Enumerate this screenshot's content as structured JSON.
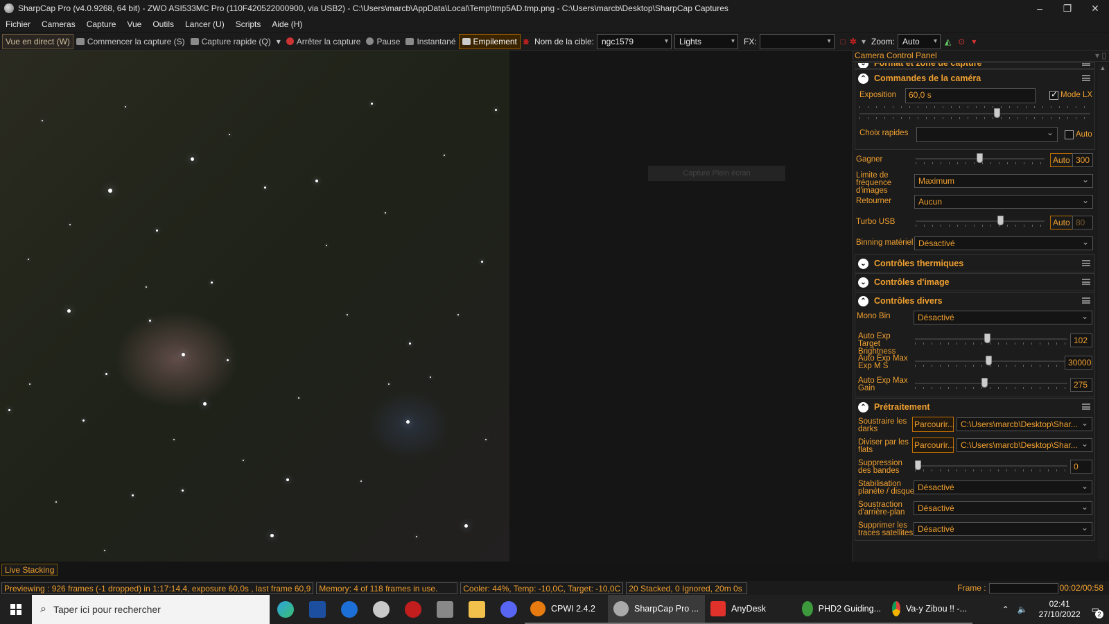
{
  "window": {
    "title": "SharpCap Pro (v4.0.9268, 64 bit) - ZWO ASI533MC Pro (110F420522000900, via USB2) - C:\\Users\\marcb\\AppData\\Local\\Temp\\tmp5AD.tmp.png - C:\\Users\\marcb\\Desktop\\SharpCap Captures"
  },
  "menu": [
    "Fichier",
    "Cameras",
    "Capture",
    "Vue",
    "Outils",
    "Lancer (U)",
    "Scripts",
    "Aide (H)"
  ],
  "toolbar": {
    "live_view": "Vue en direct (W)",
    "start_capture": "Commencer la capture (S)",
    "quick_capture": "Capture rapide (Q)",
    "stop_capture": "Arrêter la capture",
    "pause": "Pause",
    "snapshot": "Instantané",
    "stacking": "Empilement",
    "target_label": "Nom de la cible:",
    "target_value": "ngc1579",
    "frame_type": "Lights",
    "fx_label": "FX:",
    "fx_value": "",
    "zoom_label": "Zoom:",
    "zoom_value": "Auto"
  },
  "viewer": {
    "overlay_button": "Capture Plein écran"
  },
  "live_stacking_tab": "Live Stacking",
  "panel": {
    "title": "Camera Control Panel",
    "section_format": "Format et zone de capture",
    "section_camera": "Commandes de la caméra",
    "exposure_label": "Exposition",
    "exposure_value": "60,0 s",
    "lx_mode": "Mode LX",
    "quick_choice_label": "Choix rapides",
    "quick_choice_value": "",
    "auto_label": "Auto",
    "gain_label": "Gagner",
    "gain_auto": "Auto",
    "gain_value": "300",
    "framerate_label": "Limite de fréquence d'images",
    "framerate_value": "Maximum",
    "flip_label": "Retourner",
    "flip_value": "Aucun",
    "usb_label": "Turbo USB",
    "usb_auto": "Auto",
    "usb_value": "80",
    "binning_label": "Binning matériel",
    "binning_value": "Désactivé",
    "section_thermal": "Contrôles thermiques",
    "section_image": "Contrôles d'image",
    "section_misc": "Contrôles divers",
    "monobin_label": "Mono Bin",
    "monobin_value": "Désactivé",
    "ae_bright_label": "Auto Exp Target Brightness",
    "ae_bright_value": "102",
    "ae_maxexp_label": "Auto Exp Max Exp M S",
    "ae_maxexp_value": "30000",
    "ae_maxgain_label": "Auto Exp Max Gain",
    "ae_maxgain_value": "275",
    "section_pre": "Prétraitement",
    "darks_label": "Soustraire les darks",
    "browse": "Parcourir...",
    "darks_path": "C:\\Users\\marcb\\Desktop\\Shar...",
    "flats_label": "Diviser par les flats",
    "flats_path": "C:\\Users\\marcb\\Desktop\\Shar...",
    "banding_label": "Suppression des bandes",
    "banding_value": "0",
    "stab_label": "Stabilisation planète / disque",
    "stab_value": "Désactivé",
    "bg_label": "Soustraction d'arrière-plan",
    "bg_value": "Désactivé",
    "sat_label": "Supprimer les traces satellites",
    "sat_value": "Désactivé"
  },
  "status": {
    "preview": "Previewing : 926 frames (-1 dropped) in 1:17:14,4, exposure 60,0s , last frame 60,9",
    "memory": "Memory: 4 of 118 frames in use.",
    "cooler": "Cooler: 44%, Temp: -10,0C, Target: -10,0C",
    "stacked": "20 Stacked, 0 Ignored, 20m 0s",
    "frame_label": "Frame :",
    "frame_time": "00:02/00:58"
  },
  "taskbar": {
    "search_placeholder": "Taper ici pour rechercher",
    "apps": [
      "CPWI 2.4.2",
      "SharpCap Pro ...",
      "AnyDesk",
      "PHD2 Guiding...",
      "Va-y Zibou !! -..."
    ],
    "time": "02:41",
    "date": "27/10/2022",
    "notif_count": "2"
  }
}
